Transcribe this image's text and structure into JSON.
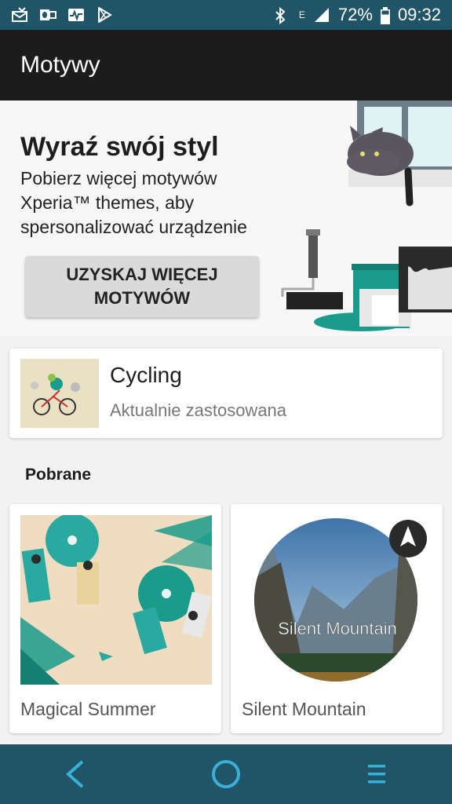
{
  "status_bar": {
    "battery": "72%",
    "time": "09:32",
    "network": "E",
    "icons": [
      "mail-sync-icon",
      "outlook-icon",
      "activity-icon",
      "play-store-icon",
      "bluetooth-icon",
      "signal-icon",
      "battery-icon"
    ]
  },
  "app_bar": {
    "title": "Motywy"
  },
  "hero": {
    "title": "Wyraź swój styl",
    "description": "Pobierz więcej motywów Xperia™ themes, aby spersonalizować urządzenie",
    "button_label": "UZYSKAJ WIĘCEJ MOTYWÓW"
  },
  "current_theme": {
    "name": "Cycling",
    "status": "Aktualnie zastosowana"
  },
  "downloaded": {
    "section_title": "Pobrane",
    "themes": [
      {
        "name": "Magical Summer"
      },
      {
        "name": "Silent Mountain",
        "thumb_text": "Silent Mountain"
      }
    ]
  },
  "nav_bar": {
    "icons": [
      "back-icon",
      "home-icon",
      "recents-icon"
    ]
  },
  "colors": {
    "status_bar": "#1f5566",
    "app_bar": "#1c1c1c",
    "nav_bar": "#1f5566",
    "accent_teal": "#1b9b8c",
    "nav_icon": "#3ab0d8"
  }
}
